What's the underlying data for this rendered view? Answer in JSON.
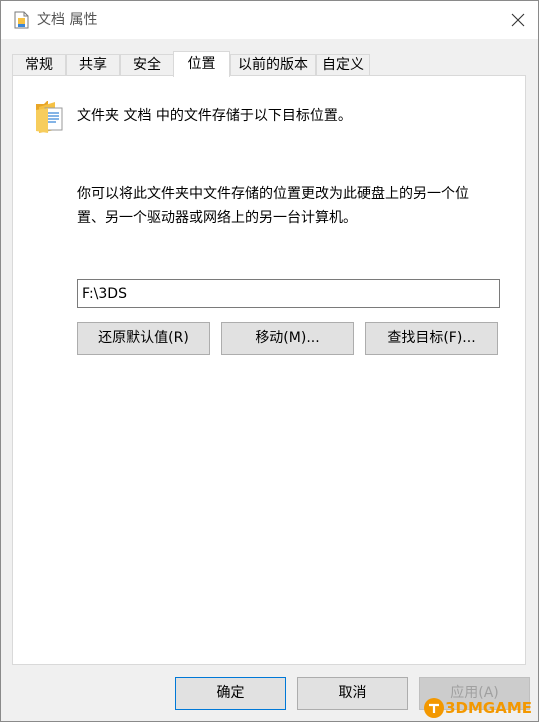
{
  "window": {
    "title": "文档 属性"
  },
  "tabs": [
    {
      "label": "常规",
      "active": false
    },
    {
      "label": "共享",
      "active": false
    },
    {
      "label": "安全",
      "active": false
    },
    {
      "label": "位置",
      "active": true
    },
    {
      "label": "以前的版本",
      "active": false
    },
    {
      "label": "自定义",
      "active": false
    }
  ],
  "location": {
    "folder_description": "文件夹 文档 中的文件存储于以下目标位置。",
    "hint_line1": "你可以将此文件夹中文件存储的位置更改为此硬盘上的另一个位",
    "hint_line2": "置、另一个驱动器或网络上的另一台计算机。",
    "path_value": "F:\\3DS",
    "restore_default_label": "还原默认值(R)",
    "move_label": "移动(M)...",
    "find_target_label": "查找目标(F)..."
  },
  "footer": {
    "ok_label": "确定",
    "cancel_label": "取消",
    "apply_label": "应用(A)"
  },
  "watermark": {
    "text": "3DMGAME"
  },
  "colors": {
    "accent": "#0078d7",
    "folder": "#f5c144",
    "watermark": "#f39800"
  }
}
